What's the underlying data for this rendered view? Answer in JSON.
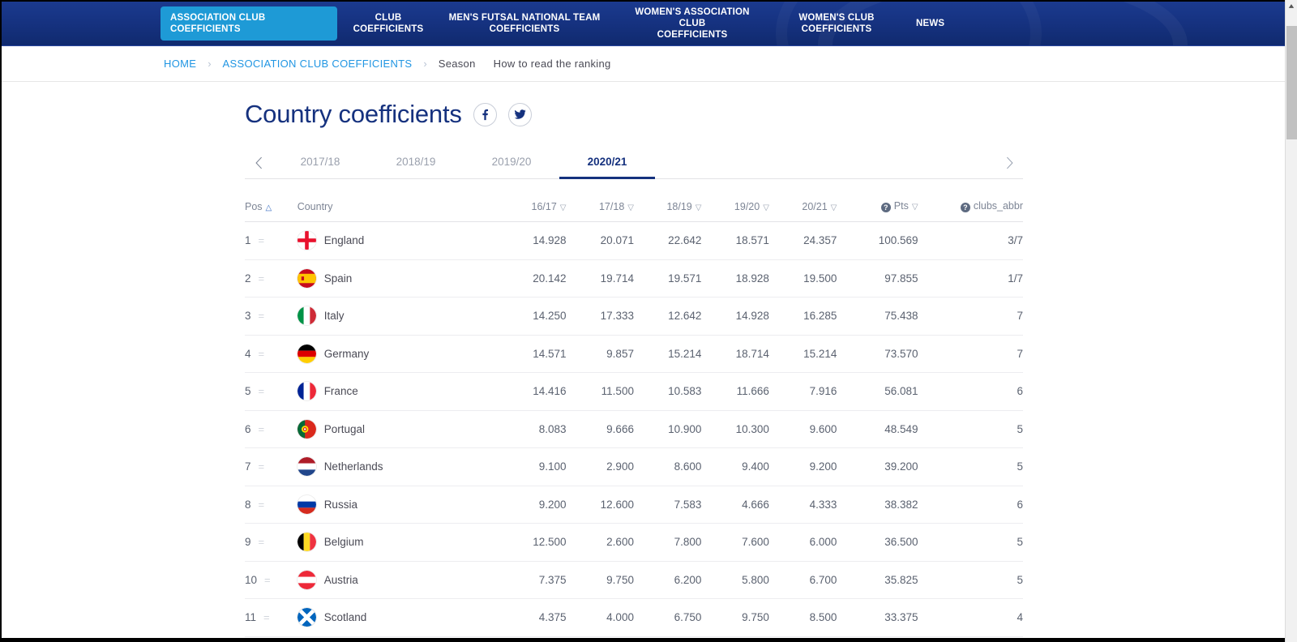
{
  "topnav": {
    "items": [
      {
        "label": "ASSOCIATION CLUB\nCOEFFICIENTS",
        "active": true
      },
      {
        "label": "CLUB\nCOEFFICIENTS",
        "active": false
      },
      {
        "label": "MEN'S FUTSAL NATIONAL TEAM\nCOEFFICIENTS",
        "active": false
      },
      {
        "label": "WOMEN'S ASSOCIATION CLUB\nCOEFFICIENTS",
        "active": false
      },
      {
        "label": "WOMEN'S CLUB\nCOEFFICIENTS",
        "active": false
      },
      {
        "label": "NEWS",
        "active": false
      }
    ],
    "active_bg": "#1e9ad6",
    "bar_bg": "#15317e"
  },
  "breadcrumb": {
    "home": "HOME",
    "section": "ASSOCIATION CLUB COEFFICIENTS",
    "season": "Season",
    "how_to_read": "How to read the ranking",
    "separator": "›",
    "link_color": "#2196e3"
  },
  "header": {
    "title": "Country coefficients",
    "title_color": "#15317e",
    "facebook_label": "f",
    "twitter_label": "twitter-bird"
  },
  "seasons": {
    "prev_label": "‹",
    "next_label": "›",
    "tabs": [
      {
        "label": "2017/18",
        "active": false
      },
      {
        "label": "2018/19",
        "active": false
      },
      {
        "label": "2019/20",
        "active": false
      },
      {
        "label": "2020/21",
        "active": true
      }
    ]
  },
  "table": {
    "columns": [
      {
        "key": "pos",
        "label": "Pos",
        "sort": "asc",
        "info": false
      },
      {
        "key": "country",
        "label": "Country",
        "sort": null,
        "info": false
      },
      {
        "key": "y1617",
        "label": "16/17",
        "sort": "desc",
        "info": false
      },
      {
        "key": "y1718",
        "label": "17/18",
        "sort": "desc",
        "info": false
      },
      {
        "key": "y1819",
        "label": "18/19",
        "sort": "desc",
        "info": false
      },
      {
        "key": "y1920",
        "label": "19/20",
        "sort": "desc",
        "info": false
      },
      {
        "key": "y2021",
        "label": "20/21",
        "sort": "desc",
        "info": false
      },
      {
        "key": "pts",
        "label": "Pts",
        "sort": "desc",
        "info": true
      },
      {
        "key": "clubs",
        "label": "clubs_abbr",
        "sort": null,
        "info": true
      }
    ],
    "move_indicator": "=",
    "rows": [
      {
        "pos": "1",
        "country": "England",
        "flag": "england",
        "y1617": "14.928",
        "y1718": "20.071",
        "y1819": "22.642",
        "y1920": "18.571",
        "y2021": "24.357",
        "pts": "100.569",
        "clubs": "3/7"
      },
      {
        "pos": "2",
        "country": "Spain",
        "flag": "spain",
        "y1617": "20.142",
        "y1718": "19.714",
        "y1819": "19.571",
        "y1920": "18.928",
        "y2021": "19.500",
        "pts": "97.855",
        "clubs": "1/7"
      },
      {
        "pos": "3",
        "country": "Italy",
        "flag": "italy",
        "y1617": "14.250",
        "y1718": "17.333",
        "y1819": "12.642",
        "y1920": "14.928",
        "y2021": "16.285",
        "pts": "75.438",
        "clubs": "7"
      },
      {
        "pos": "4",
        "country": "Germany",
        "flag": "germany",
        "y1617": "14.571",
        "y1718": "9.857",
        "y1819": "15.214",
        "y1920": "18.714",
        "y2021": "15.214",
        "pts": "73.570",
        "clubs": "7"
      },
      {
        "pos": "5",
        "country": "France",
        "flag": "france",
        "y1617": "14.416",
        "y1718": "11.500",
        "y1819": "10.583",
        "y1920": "11.666",
        "y2021": "7.916",
        "pts": "56.081",
        "clubs": "6"
      },
      {
        "pos": "6",
        "country": "Portugal",
        "flag": "portugal",
        "y1617": "8.083",
        "y1718": "9.666",
        "y1819": "10.900",
        "y1920": "10.300",
        "y2021": "9.600",
        "pts": "48.549",
        "clubs": "5"
      },
      {
        "pos": "7",
        "country": "Netherlands",
        "flag": "netherlands",
        "y1617": "9.100",
        "y1718": "2.900",
        "y1819": "8.600",
        "y1920": "9.400",
        "y2021": "9.200",
        "pts": "39.200",
        "clubs": "5"
      },
      {
        "pos": "8",
        "country": "Russia",
        "flag": "russia",
        "y1617": "9.200",
        "y1718": "12.600",
        "y1819": "7.583",
        "y1920": "4.666",
        "y2021": "4.333",
        "pts": "38.382",
        "clubs": "6"
      },
      {
        "pos": "9",
        "country": "Belgium",
        "flag": "belgium",
        "y1617": "12.500",
        "y1718": "2.600",
        "y1819": "7.800",
        "y1920": "7.600",
        "y2021": "6.000",
        "pts": "36.500",
        "clubs": "5"
      },
      {
        "pos": "10",
        "country": "Austria",
        "flag": "austria",
        "y1617": "7.375",
        "y1718": "9.750",
        "y1819": "6.200",
        "y1920": "5.800",
        "y2021": "6.700",
        "pts": "35.825",
        "clubs": "5"
      },
      {
        "pos": "11",
        "country": "Scotland",
        "flag": "scotland",
        "y1617": "4.375",
        "y1718": "4.000",
        "y1819": "6.750",
        "y1920": "9.750",
        "y2021": "8.500",
        "pts": "33.375",
        "clubs": "4"
      }
    ]
  }
}
